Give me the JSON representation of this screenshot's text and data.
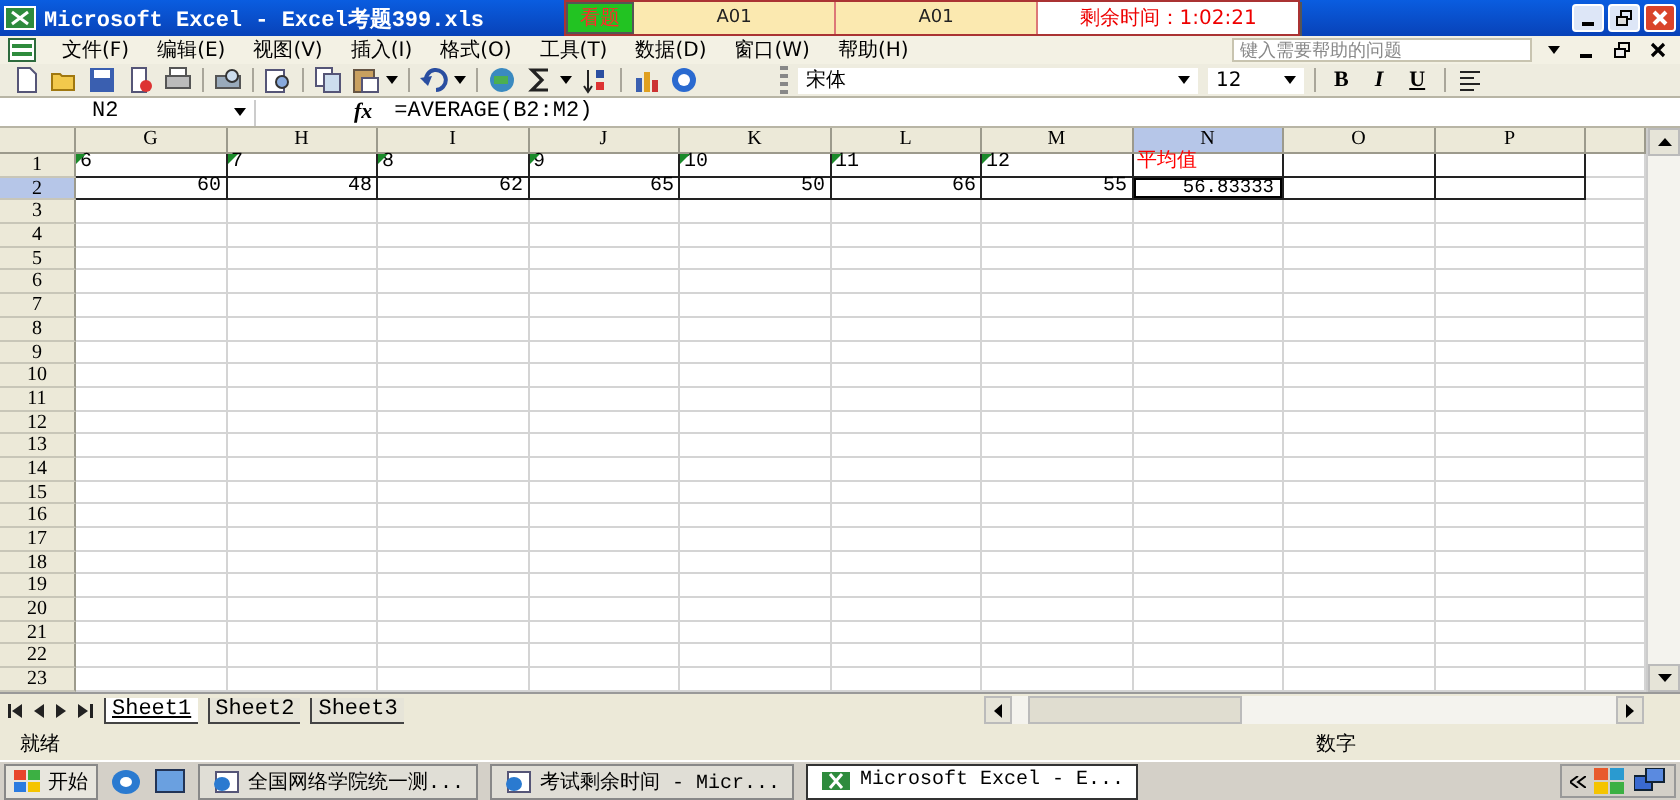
{
  "title_bar": {
    "title": "Microsoft Excel - Excel考题399.xls"
  },
  "exam_overlay": {
    "button": "看题",
    "fields": [
      "A01",
      "A01"
    ],
    "timer": "剩余时间：1:02:21"
  },
  "menu": {
    "items": [
      "文件(F)",
      "编辑(E)",
      "视图(V)",
      "插入(I)",
      "格式(O)",
      "工具(T)",
      "数据(D)",
      "窗口(W)",
      "帮助(H)"
    ],
    "help_placeholder": "键入需要帮助的问题"
  },
  "format_toolbar": {
    "font": "宋体",
    "size": "12",
    "buttons": [
      "B",
      "I",
      "U"
    ]
  },
  "formula_bar": {
    "name_box": "N2",
    "fx": "fx",
    "formula": "=AVERAGE(B2:M2)"
  },
  "sheet": {
    "columns": [
      {
        "label": "G",
        "selected": false
      },
      {
        "label": "H",
        "selected": false
      },
      {
        "label": "I",
        "selected": false
      },
      {
        "label": "J",
        "selected": false
      },
      {
        "label": "K",
        "selected": false
      },
      {
        "label": "L",
        "selected": false
      },
      {
        "label": "M",
        "selected": false
      },
      {
        "label": "N",
        "selected": true
      },
      {
        "label": "O",
        "selected": false
      },
      {
        "label": "P",
        "selected": false
      }
    ],
    "rows": [
      {
        "label": "1",
        "selected": false,
        "cells": [
          {
            "value": "6",
            "kind": "text",
            "error_flag": true,
            "selected": false
          },
          {
            "value": "7",
            "kind": "text",
            "error_flag": true,
            "selected": false
          },
          {
            "value": "8",
            "kind": "text",
            "error_flag": true,
            "selected": false
          },
          {
            "value": "9",
            "kind": "text",
            "error_flag": true,
            "selected": false
          },
          {
            "value": "10",
            "kind": "text",
            "error_flag": true,
            "selected": false
          },
          {
            "value": "11",
            "kind": "text",
            "error_flag": true,
            "selected": false
          },
          {
            "value": "12",
            "kind": "text",
            "error_flag": true,
            "selected": false
          },
          {
            "value": "平均值",
            "kind": "text",
            "error_flag": false,
            "selected": false,
            "color": "#ff0000"
          }
        ]
      },
      {
        "label": "2",
        "selected": true,
        "cells": [
          {
            "value": "60",
            "kind": "number",
            "error_flag": false,
            "selected": false
          },
          {
            "value": "48",
            "kind": "number",
            "error_flag": false,
            "selected": false
          },
          {
            "value": "62",
            "kind": "number",
            "error_flag": false,
            "selected": false
          },
          {
            "value": "65",
            "kind": "number",
            "error_flag": false,
            "selected": false
          },
          {
            "value": "50",
            "kind": "number",
            "error_flag": false,
            "selected": false
          },
          {
            "value": "66",
            "kind": "number",
            "error_flag": false,
            "selected": false
          },
          {
            "value": "55",
            "kind": "number",
            "error_flag": false,
            "selected": false
          },
          {
            "value": "56.83333",
            "kind": "number",
            "error_flag": false,
            "selected": true
          }
        ]
      },
      {
        "label": "3",
        "selected": false
      },
      {
        "label": "4",
        "selected": false
      },
      {
        "label": "5",
        "selected": false
      },
      {
        "label": "6",
        "selected": false
      },
      {
        "label": "7",
        "selected": false
      },
      {
        "label": "8",
        "selected": false
      },
      {
        "label": "9",
        "selected": false
      },
      {
        "label": "10",
        "selected": false
      },
      {
        "label": "11",
        "selected": false
      },
      {
        "label": "12",
        "selected": false
      },
      {
        "label": "13",
        "selected": false
      },
      {
        "label": "14",
        "selected": false
      },
      {
        "label": "15",
        "selected": false
      },
      {
        "label": "16",
        "selected": false
      },
      {
        "label": "17",
        "selected": false
      },
      {
        "label": "18",
        "selected": false
      },
      {
        "label": "19",
        "selected": false
      },
      {
        "label": "20",
        "selected": false
      },
      {
        "label": "21",
        "selected": false
      },
      {
        "label": "22",
        "selected": false
      },
      {
        "label": "23",
        "selected": false
      }
    ]
  },
  "sheet_tabs": [
    {
      "label": "Sheet1",
      "selected": true
    },
    {
      "label": "Sheet2",
      "selected": false
    },
    {
      "label": "Sheet3",
      "selected": false
    }
  ],
  "status_bar": {
    "left": "就绪",
    "right": "数字"
  },
  "taskbar": {
    "start": "开始",
    "tasks": [
      {
        "label": "全国网络学院统一测...",
        "selected": false
      },
      {
        "label": "考试剩余时间 - Micr...",
        "selected": false
      },
      {
        "label": "Microsoft Excel - E...",
        "selected": true
      }
    ]
  }
}
